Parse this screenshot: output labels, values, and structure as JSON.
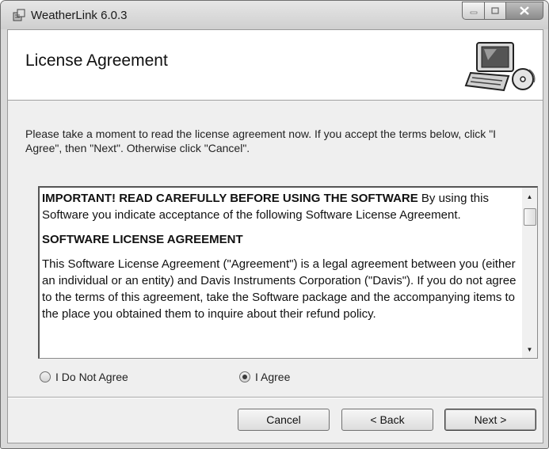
{
  "window": {
    "title": "WeatherLink 6.0.3",
    "icon": "installer-icon"
  },
  "header": {
    "title": "License Agreement",
    "icon": "computer-with-cd-icon"
  },
  "instructions": "Please take a moment to read the license agreement now. If you accept the terms below, click \"I Agree\", then \"Next\". Otherwise click \"Cancel\".",
  "license": {
    "p1_bold": "IMPORTANT! READ CAREFULLY BEFORE USING THE SOFTWARE",
    "p1_rest": " By using this Software you indicate acceptance of the following Software License Agreement.",
    "heading": "SOFTWARE LICENSE AGREEMENT",
    "p2": "This Software License Agreement (\"Agreement\") is a legal agreement between you (either an individual or an entity) and Davis Instruments Corporation (\"Davis\"). If you do not agree to the terms of this agreement, take the Software package and the accompanying items to the place you obtained them to inquire about their refund policy."
  },
  "options": {
    "disagree": "I Do Not Agree",
    "agree": "I Agree",
    "selected": "I Agree"
  },
  "buttons": {
    "cancel": "Cancel",
    "back": "< Back",
    "next": "Next >"
  }
}
